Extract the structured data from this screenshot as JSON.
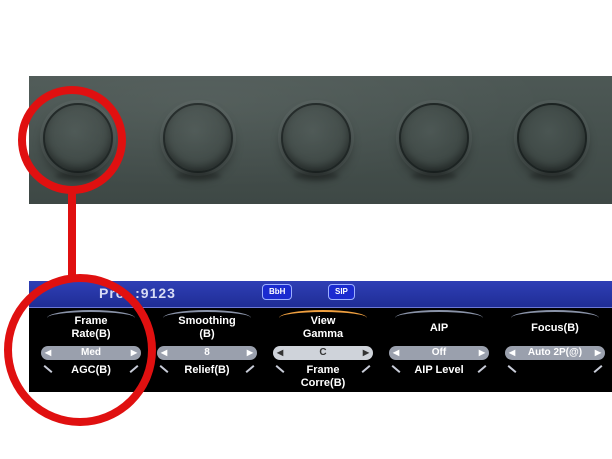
{
  "header": {
    "probe_label": "Pro..:9123",
    "pills": [
      "BbH",
      "SIP"
    ]
  },
  "controls": [
    {
      "top_label": "Frame\nRate(B)",
      "value": "Med",
      "bottom_label": "AGC(B)",
      "highlighted": true
    },
    {
      "top_label": "Smoothing\n(B)",
      "value": "8",
      "bottom_label": "Relief(B)",
      "highlighted": false
    },
    {
      "top_label": "View\nGamma",
      "value": "C",
      "bottom_label": "Frame\nCorre(B)",
      "highlighted": false,
      "selected": true
    },
    {
      "top_label": "AIP",
      "value": "Off",
      "bottom_label": "AIP Level",
      "highlighted": false
    },
    {
      "top_label": "Focus(B)",
      "value": "Auto 2P(@)",
      "bottom_label": "",
      "highlighted": false
    }
  ],
  "colors": {
    "annotation": "#e01010",
    "header_bar": "#1f2d96",
    "selected_arc": "#f0a040"
  },
  "icons": {
    "value_left": "triangle-left-icon",
    "value_right": "triangle-right-icon",
    "knob": "rotary-knob-icon"
  }
}
